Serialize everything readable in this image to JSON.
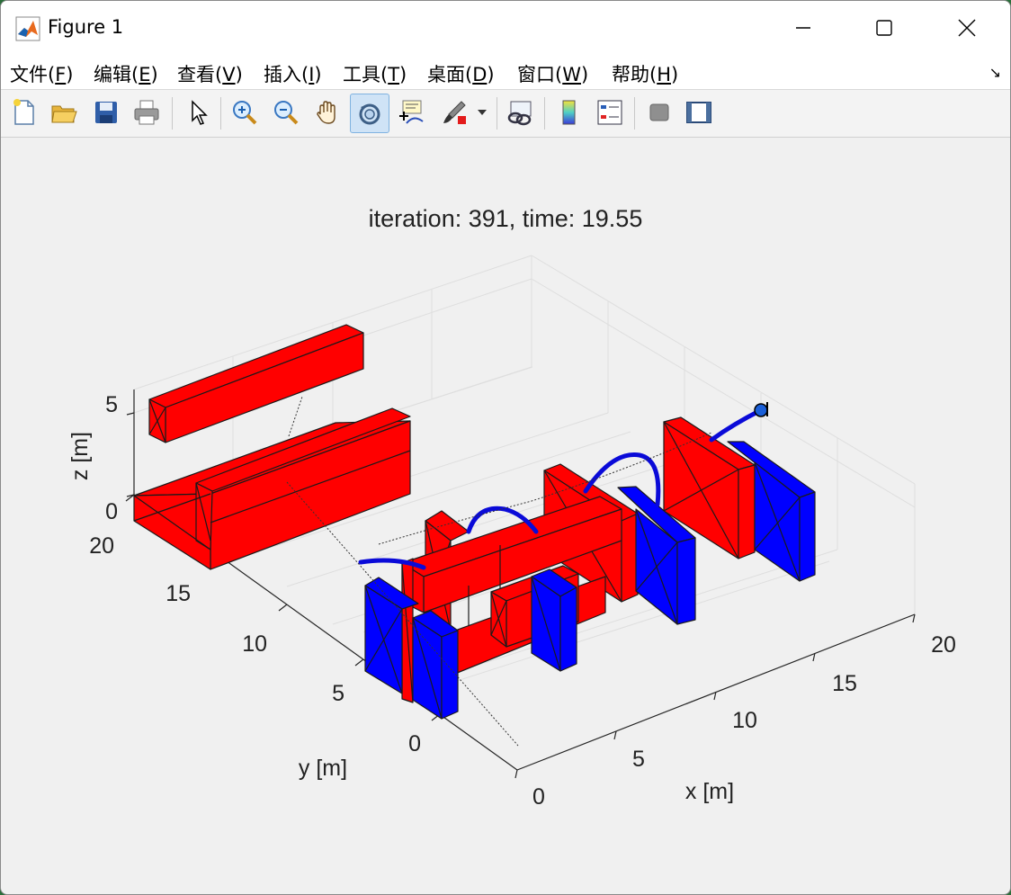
{
  "window": {
    "title": "Figure 1"
  },
  "menu": {
    "items": [
      "文件(F)",
      "编辑(E)",
      "查看(V)",
      "插入(I)",
      "工具(T)",
      "桌面(D)",
      "窗口(W)",
      "帮助(H)"
    ],
    "mnemonics": [
      "F",
      "E",
      "V",
      "I",
      "T",
      "D",
      "W",
      "H"
    ]
  },
  "toolbar": {
    "icons": [
      "new-figure-icon",
      "open-file-icon",
      "save-icon",
      "print-icon",
      "edit-plot-icon",
      "zoom-in-icon",
      "zoom-out-icon",
      "pan-icon",
      "rotate-3d-icon",
      "data-cursor-icon",
      "brush-icon",
      "link-plot-icon",
      "colorbar-icon",
      "legend-icon",
      "hide-plot-tools-icon",
      "show-plot-tools-icon"
    ],
    "active": "rotate-3d-icon"
  },
  "plot": {
    "title": "iteration: 391, time: 19.55",
    "xlabel": "x [m]",
    "ylabel": "y [m]",
    "zlabel": "z [m]",
    "xticks": [
      "0",
      "5",
      "10",
      "15",
      "20"
    ],
    "yticks": [
      "0",
      "5",
      "10",
      "15",
      "20"
    ],
    "zticks": [
      "0",
      "5"
    ],
    "colors": {
      "obstacle_red": "#ff0000",
      "obstacle_blue": "#0000ff",
      "trajectory": "#0000d8",
      "grid": "#dcdcdc"
    }
  }
}
